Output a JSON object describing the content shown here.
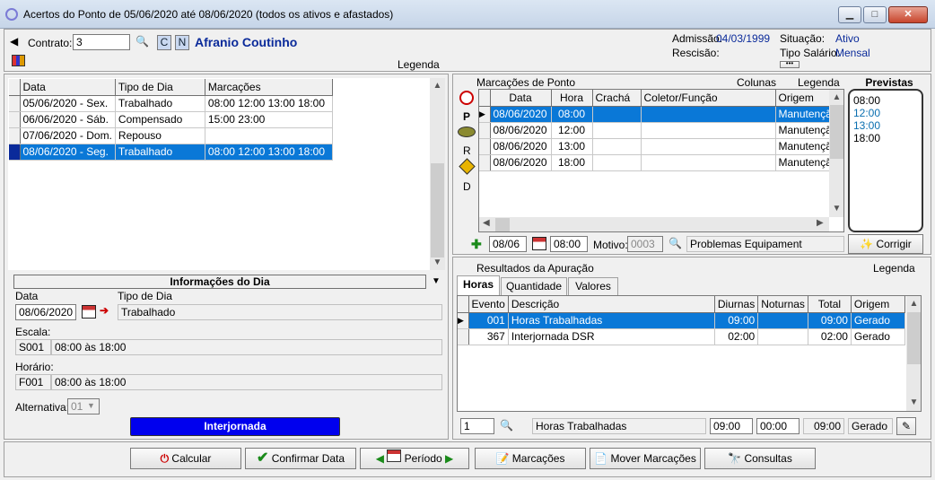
{
  "window": {
    "title": "Acertos do Ponto de 05/06/2020 até 08/06/2020 (todos os ativos e afastados)",
    "min": "▁",
    "max": "□",
    "close": "✕"
  },
  "header": {
    "contract_label": "Contrato:",
    "contract_value": "3",
    "btn_c": "C",
    "btn_n": "N",
    "employee_name": "Afranio Coutinho",
    "admission_label": "Admissão:",
    "admission_value": "04/03/1999",
    "rescission_label": "Rescisão:",
    "situation_label": "Situação:",
    "situation_value": "Ativo",
    "salary_type_label": "Tipo Salário:",
    "salary_type_value": "Mensal",
    "legend": "Legenda",
    "more": "•••"
  },
  "days": {
    "columns": [
      "Data",
      "Tipo de Dia",
      "Marcações"
    ],
    "rows": [
      [
        "05/06/2020 - Sex.",
        "Trabalhado",
        "08:00  12:00  13:00  18:00"
      ],
      [
        "06/06/2020 - Sáb.",
        "Compensado",
        "15:00  23:00"
      ],
      [
        "07/06/2020 - Dom.",
        "Repouso",
        ""
      ],
      [
        "08/06/2020 - Seg.",
        "Trabalhado",
        "08:00  12:00  13:00  18:00"
      ]
    ]
  },
  "day_info": {
    "title": "Informações do Dia",
    "date_label": "Data",
    "day_type_label": "Tipo de Dia",
    "date_value": "08/06/2020",
    "day_type_value": "Trabalhado",
    "scale_label": "Escala:",
    "scale_code": "S001",
    "scale_desc": "08:00 às 18:00",
    "schedule_label": "Horário:",
    "schedule_code": "F001",
    "schedule_desc": "08:00 às 18:00",
    "alternative_label": "Alternativa:",
    "alternative_value": "01",
    "status_bar": "Interjornada"
  },
  "punches": {
    "title": "Marcações de Ponto",
    "columns_label": "Colunas",
    "legend": "Legenda",
    "side_letters": [
      "P",
      "R",
      "D"
    ],
    "columns": [
      "Data",
      "Hora",
      "Crachá",
      "Coletor/Função",
      "Origem"
    ],
    "rows": [
      [
        "08/06/2020",
        "08:00",
        "",
        "",
        "Manutenção"
      ],
      [
        "08/06/2020",
        "12:00",
        "",
        "",
        "Manutenção"
      ],
      [
        "08/06/2020",
        "13:00",
        "",
        "",
        "Manutenção"
      ],
      [
        "08/06/2020",
        "18:00",
        "",
        "",
        "Manutenção"
      ]
    ],
    "edit_date": "08/06",
    "edit_time": "08:00",
    "reason_label": "Motivo:",
    "reason_code": "0003",
    "reason_desc": "Problemas Equipament"
  },
  "expected": {
    "title": "Previstas",
    "times": [
      "08:00",
      "12:00",
      "13:00",
      "18:00"
    ],
    "fix_button": "Corrigir",
    "colors": [
      "#000000",
      "#0a6fb0",
      "#0a6fb0",
      "#000000"
    ]
  },
  "results": {
    "title": "Resultados da Apuração",
    "legend": "Legenda",
    "tabs": [
      "Horas",
      "Quantidade",
      "Valores"
    ],
    "columns": [
      "Evento",
      "Descrição",
      "Diurnas",
      "Noturnas",
      "Total",
      "Origem"
    ],
    "rows": [
      [
        "001",
        "Horas Trabalhadas",
        "09:00",
        "",
        "09:00",
        "Gerado"
      ],
      [
        "367",
        "Interjornada DSR",
        "02:00",
        "",
        "02:00",
        "Gerado"
      ]
    ],
    "footer_line": "1",
    "footer_desc": "Horas Trabalhadas",
    "footer_day": "09:00",
    "footer_night": "00:00",
    "footer_total": "09:00",
    "footer_origin": "Gerado"
  },
  "toolbar": {
    "calc": "Calcular",
    "confirm": "Confirmar Data",
    "period": "Período",
    "punches": "Marcações",
    "move": "Mover Marcações",
    "queries": "Consultas"
  },
  "icons": {
    "calc": "clock-icon",
    "confirm": "check-icon",
    "prev": "arrow-left-icon",
    "next": "arrow-right-icon",
    "punches": "edit-icon",
    "move": "move-icon",
    "queries": "binoculars-icon"
  },
  "colors": {
    "selection": "#0a78d7",
    "status_bar": "#0000ee",
    "name": "#0a2a9a"
  }
}
